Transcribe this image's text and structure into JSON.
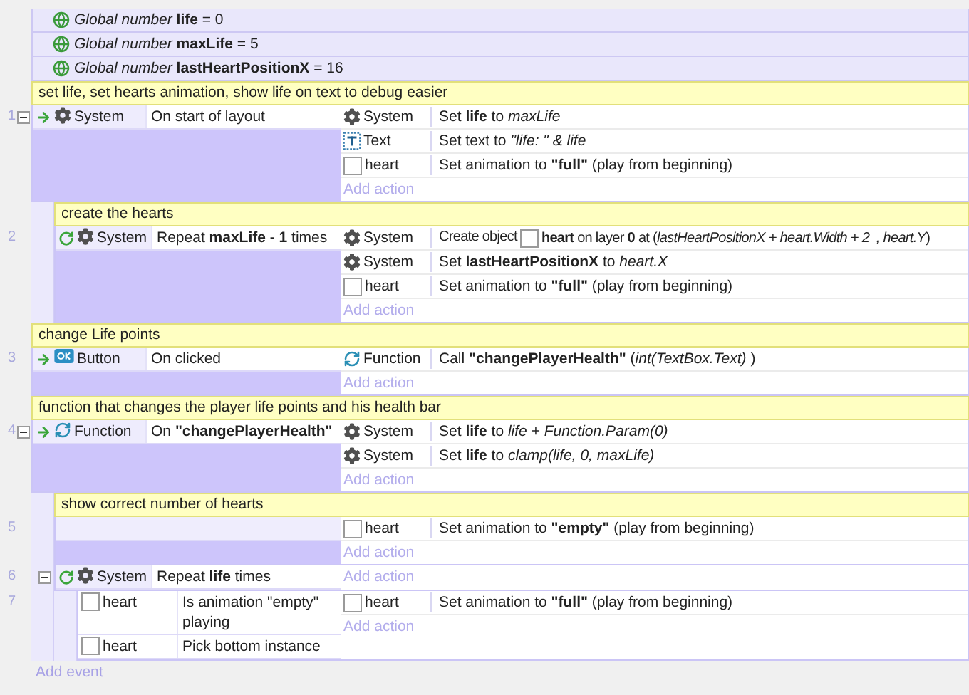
{
  "globals": [
    {
      "text": "*Global number* **life** = 0"
    },
    {
      "text": "*Global number* **maxLife** = 5"
    },
    {
      "text": "*Global number* **lastHeartPositionX** = 16"
    }
  ],
  "events": [
    {
      "kind": "comment",
      "text": "set life, set hearts animation, show life on text to debug easier"
    },
    {
      "kind": "trigger",
      "number": "1",
      "expanded": true,
      "conditions": [
        {
          "kind": "system",
          "object": "System",
          "text": "On start of layout"
        }
      ],
      "actions": [
        {
          "kind": "system",
          "object": "System",
          "text": "Set **life** to *maxLife*"
        },
        {
          "kind": "text",
          "object": "Text",
          "text": "Set text to *\"life: \" & life*"
        },
        {
          "kind": "sprite",
          "object": "heart",
          "text": "Set animation to **\"full\"** (play from beginning)"
        }
      ],
      "add_action": "Add action",
      "children": [
        {
          "kind": "comment",
          "text": "create the hearts"
        },
        {
          "kind": "loop",
          "number": "2",
          "conditions": [
            {
              "kind": "system",
              "object": "System",
              "text": "Repeat **maxLife - 1** times"
            }
          ],
          "actions": [
            {
              "kind": "system",
              "object": "System",
              "text": "Create object",
              "inline_object": {
                "kind": "sprite",
                "text": "**heart** on layer **0** at (*lastHeartPositionX + heart.Width + 2  , heart.Y*)"
              }
            },
            {
              "kind": "system",
              "object": "System",
              "text": "Set **lastHeartPositionX** to *heart.X*"
            },
            {
              "kind": "sprite",
              "object": "heart",
              "text": "Set animation to **\"full\"** (play from beginning)"
            }
          ],
          "add_action": "Add action"
        }
      ]
    },
    {
      "kind": "comment",
      "text": "change Life points"
    },
    {
      "kind": "trigger",
      "number": "3",
      "conditions": [
        {
          "kind": "button",
          "object": "Button",
          "text": "On clicked"
        }
      ],
      "actions": [
        {
          "kind": "function",
          "object": "Function",
          "text": "Call **\"changePlayerHealth\"** (*int(TextBox.Text)* )"
        }
      ],
      "add_action": "Add action"
    },
    {
      "kind": "comment",
      "text": "function that changes the player life points and his health bar"
    },
    {
      "kind": "trigger",
      "number": "4",
      "expanded": true,
      "conditions": [
        {
          "kind": "function",
          "object": "Function",
          "text": "On **\"changePlayerHealth\"**"
        }
      ],
      "actions": [
        {
          "kind": "system",
          "object": "System",
          "text": "Set **life** to *life + Function.Param(0)*"
        },
        {
          "kind": "system",
          "object": "System",
          "text": "Set **life** to *clamp(life, 0, maxLife)*"
        }
      ],
      "add_action": "Add action",
      "children": [
        {
          "kind": "comment",
          "text": "show correct number of hearts"
        },
        {
          "kind": "plain",
          "number": "5",
          "actions": [
            {
              "kind": "sprite",
              "object": "heart",
              "text": "Set animation to **\"empty\"** (play from beginning)"
            }
          ],
          "add_action": "Add action"
        },
        {
          "kind": "loop",
          "number": "6",
          "expanded": true,
          "conditions": [
            {
              "kind": "system",
              "object": "System",
              "text": "Repeat **life** times"
            }
          ],
          "add_action": "Add action",
          "children": [
            {
              "kind": "plain",
              "number": "7",
              "conditions": [
                {
                  "kind": "sprite",
                  "object": "heart",
                  "text": "Is animation \"empty\" playing"
                },
                {
                  "kind": "sprite",
                  "object": "heart",
                  "text": "Pick bottom instance"
                }
              ],
              "actions": [
                {
                  "kind": "sprite",
                  "object": "heart",
                  "text": "Set animation to **\"full\"** (play from beginning)"
                }
              ],
              "add_action": "Add action"
            }
          ]
        }
      ]
    }
  ],
  "add_event": "Add event"
}
